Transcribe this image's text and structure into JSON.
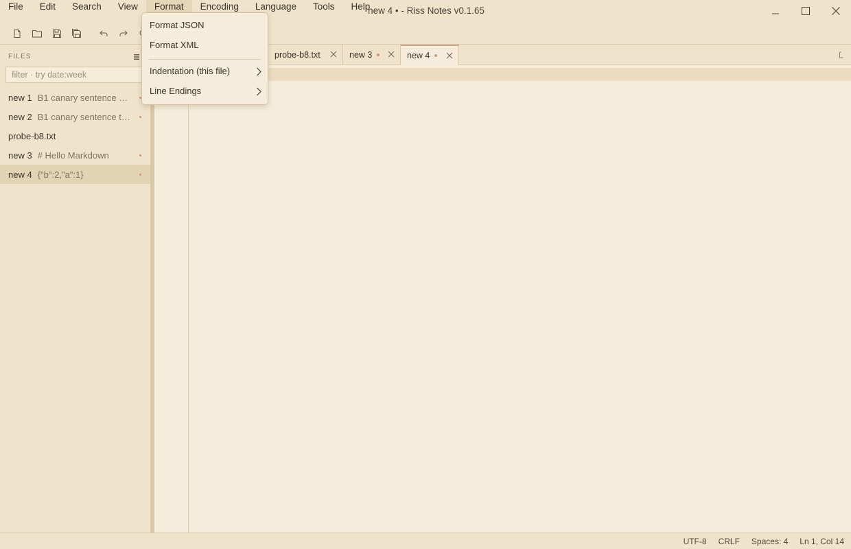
{
  "window": {
    "title": "new 4 • - Riss Notes v0.1.65"
  },
  "menubar": {
    "items": [
      "File",
      "Edit",
      "Search",
      "View",
      "Format",
      "Encoding",
      "Language",
      "Tools",
      "Help"
    ],
    "active": "Format"
  },
  "format_menu": {
    "items": [
      {
        "label": "Format JSON",
        "has_submenu": false
      },
      {
        "label": "Format XML",
        "has_submenu": false
      },
      {
        "label": "Indentation (this file)",
        "has_submenu": true
      },
      {
        "label": "Line Endings",
        "has_submenu": true
      }
    ]
  },
  "toolbar": {
    "icons": [
      "new-file-icon",
      "open-folder-icon",
      "save-icon",
      "save-all-icon",
      "undo-icon",
      "redo-icon",
      "search-icon"
    ]
  },
  "sidebar": {
    "header": "FILES",
    "filter_placeholder": "filter · try date:week",
    "files": [
      {
        "name": "new 1",
        "preview": "B1 canary sentence on...",
        "modified": true,
        "selected": false
      },
      {
        "name": "new 2",
        "preview": "B1 canary sentence tw...",
        "modified": true,
        "selected": false
      },
      {
        "name": "probe-b8.txt",
        "preview": "",
        "modified": false,
        "selected": false
      },
      {
        "name": "new 3",
        "preview": "# Hello Markdown",
        "modified": true,
        "selected": false
      },
      {
        "name": "new 4",
        "preview": "{\"b\":2,\"a\":1}",
        "modified": true,
        "selected": true
      }
    ]
  },
  "tabs": [
    {
      "label": "probe-b8.txt",
      "modified": false,
      "active": false
    },
    {
      "label": "new 3",
      "modified": true,
      "active": false
    },
    {
      "label": "new 4",
      "modified": true,
      "active": true
    }
  ],
  "statusbar": {
    "encoding": "UTF-8",
    "line_endings": "CRLF",
    "indentation": "Spaces: 4",
    "cursor": "Ln 1, Col 14"
  },
  "colors": {
    "background": "#efe3cc",
    "editor_background": "#f5ecdb",
    "accent": "#d7a58a",
    "modified_dot": "#d3967c"
  }
}
